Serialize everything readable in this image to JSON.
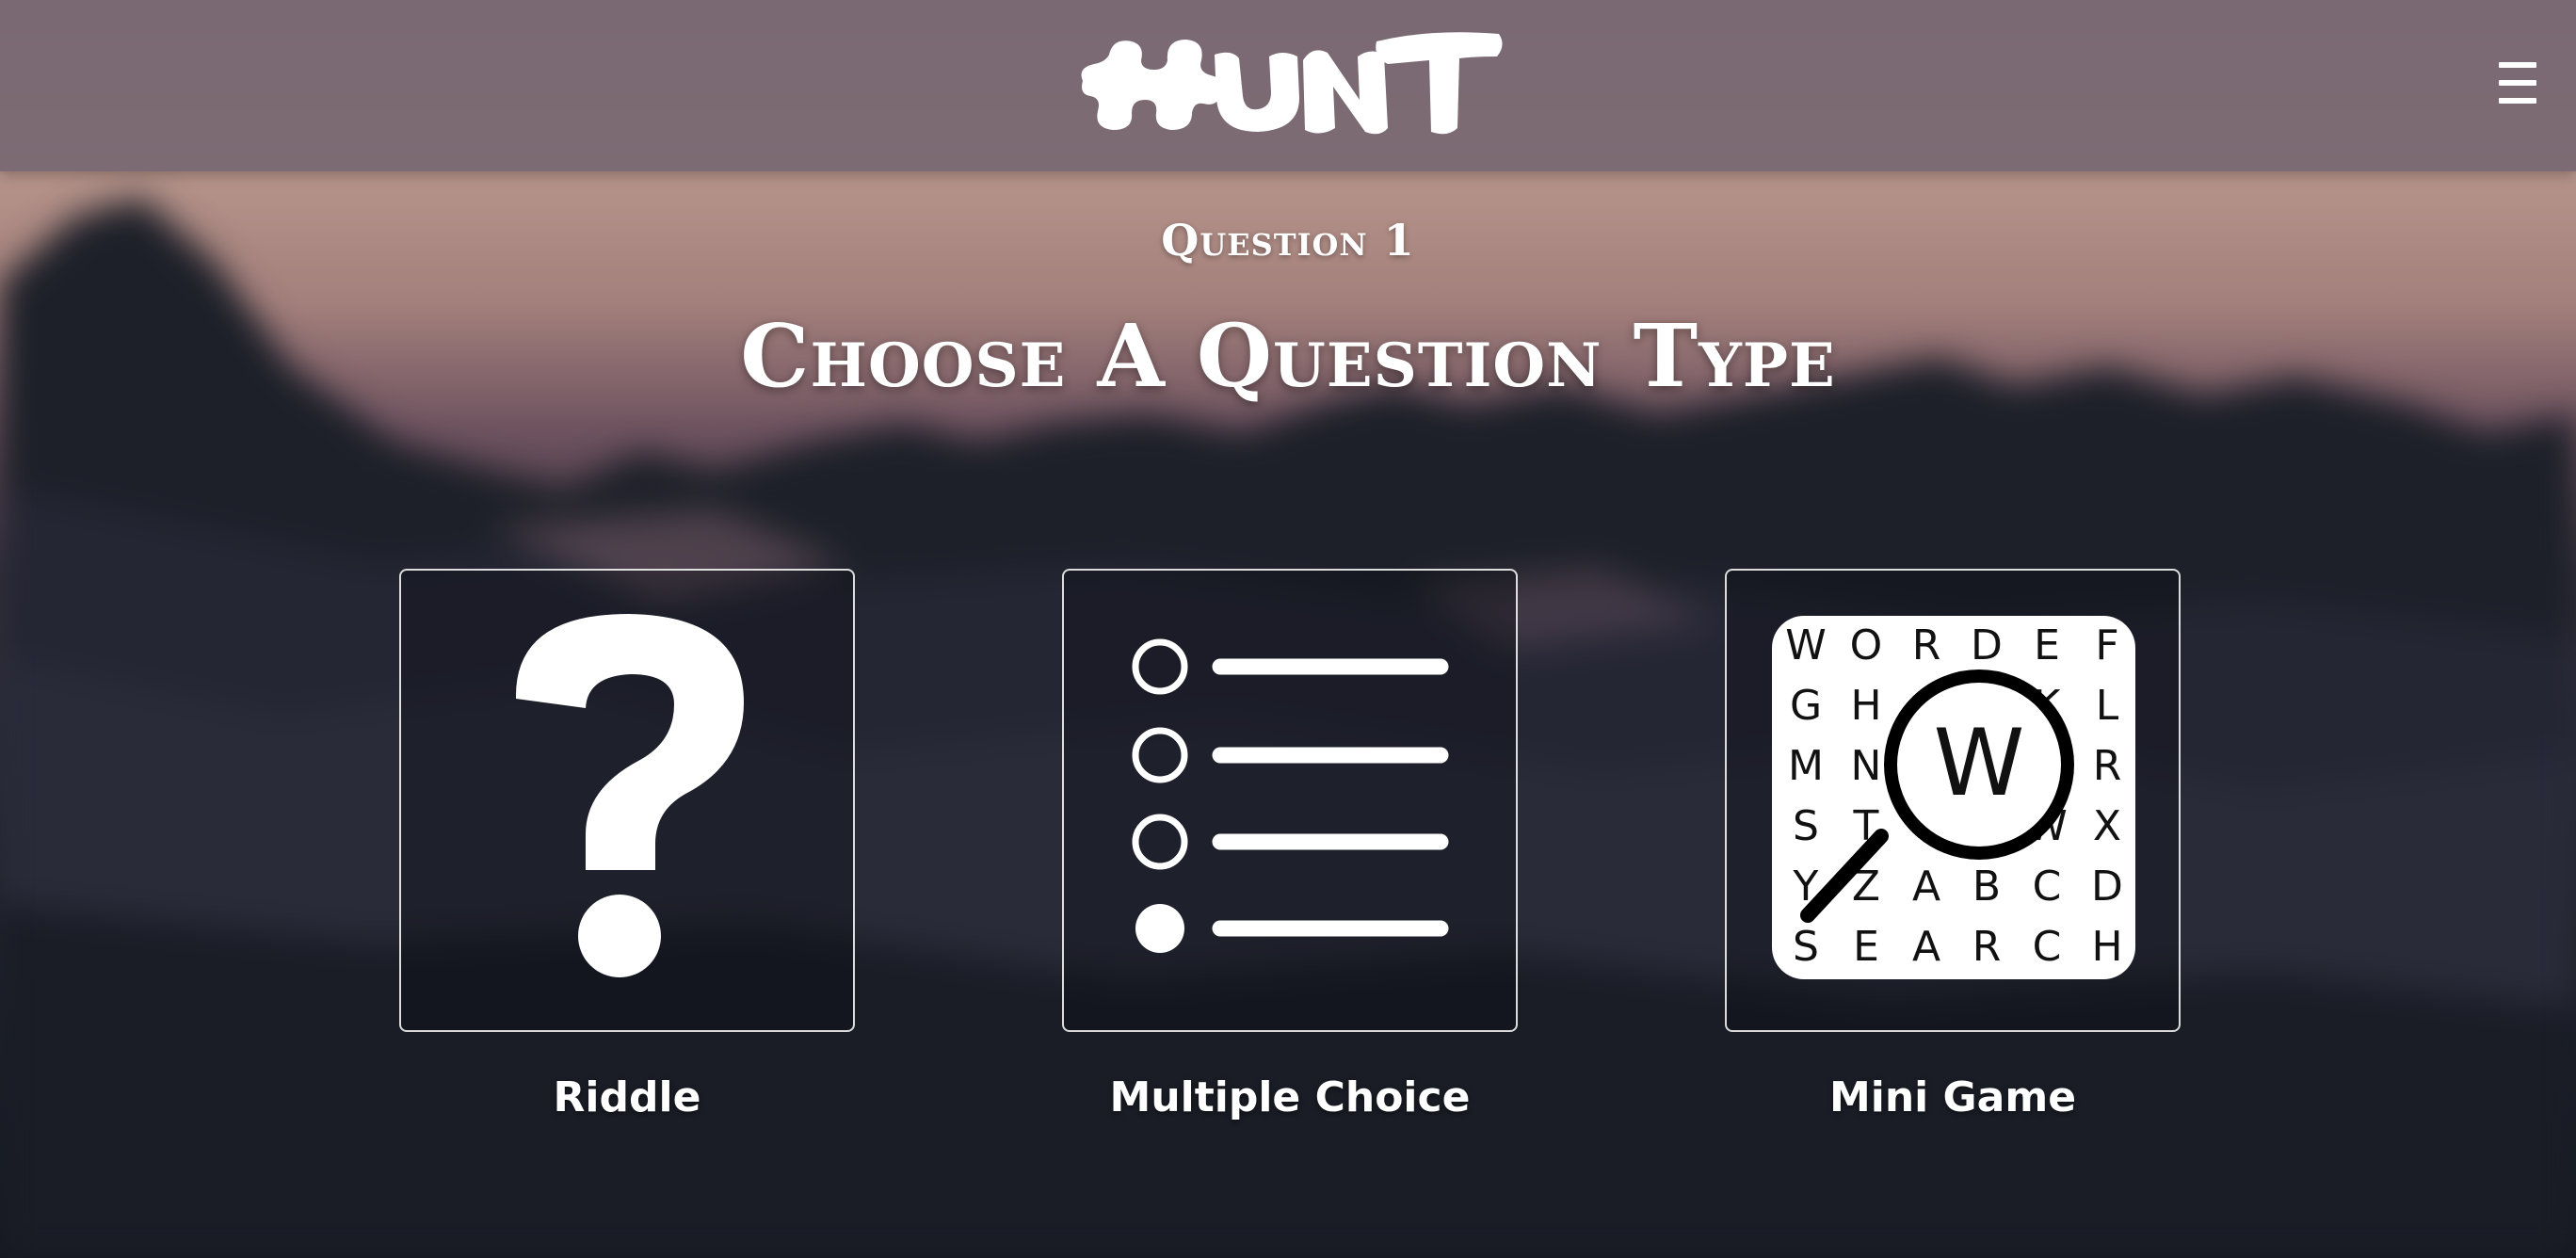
{
  "header": {
    "logo_text": "HUNT",
    "menu_icon": "hamburger-menu-icon"
  },
  "page": {
    "subtitle": "Question 1",
    "title": "Choose A Question Type"
  },
  "options": [
    {
      "label": "Riddle",
      "icon": "question-mark-icon"
    },
    {
      "label": "Multiple Choice",
      "icon": "multiple-choice-list-icon"
    },
    {
      "label": "Mini Game",
      "icon": "word-search-icon"
    }
  ],
  "word_search": {
    "rows": [
      [
        "W",
        "O",
        "R",
        "D",
        "E",
        "F"
      ],
      [
        "G",
        "H",
        "",
        "",
        "K",
        "L"
      ],
      [
        "M",
        "N",
        "",
        "",
        "",
        "R"
      ],
      [
        "S",
        "T",
        "",
        "",
        "W",
        "X"
      ],
      [
        "Y",
        "Z",
        "A",
        "B",
        "C",
        "D"
      ],
      [
        "S",
        "E",
        "A",
        "R",
        "C",
        "H"
      ]
    ],
    "magnified_letter": "W"
  },
  "colors": {
    "header_bg": "#786872",
    "text": "#ffffff"
  }
}
